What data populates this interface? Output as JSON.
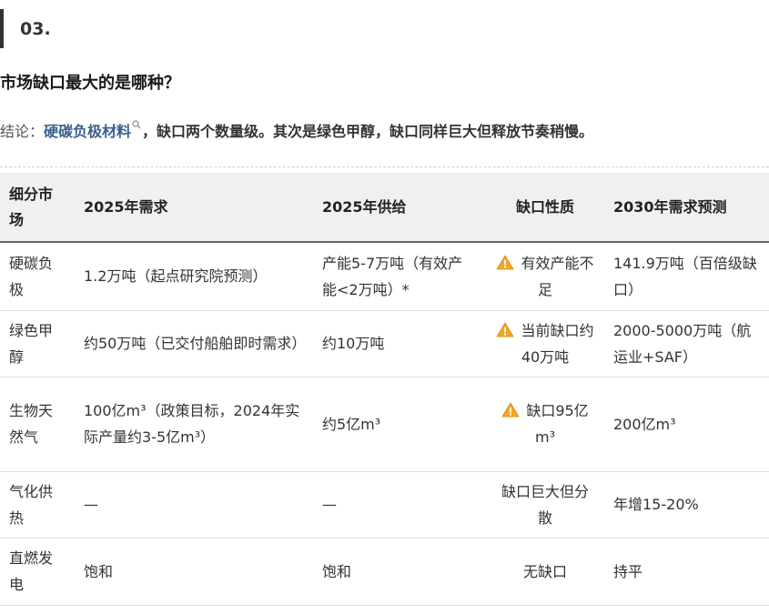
{
  "section": {
    "number": "03."
  },
  "question": "市场缺口最大的是哪种？",
  "conclusion": {
    "lead": "结论：",
    "highlight": "硬碳负极材料",
    "rest": "，缺口两个数量级。其次是绿色甲醇，缺口同样巨大但释放节奏稍慢。"
  },
  "icons": {
    "search": "search-icon",
    "warning": "warning-icon"
  },
  "colors": {
    "link": "#3b5f8f",
    "warning": "#f5a623",
    "header_bg": "#eef0f2"
  },
  "table": {
    "headers": [
      "细分市场",
      "2025年需求",
      "2025年供给",
      "缺口性质",
      "2030年需求预测"
    ],
    "rows": [
      {
        "segment": "硬碳负极",
        "demand_2025": "1.2万吨（起点研究院预测）",
        "supply_2025": "产能5-7万吨（有效产能<2万吨）*",
        "gap": "有效产能不足",
        "gap_warning": true,
        "forecast_2030": "141.9万吨（百倍级缺口）"
      },
      {
        "segment": "绿色甲醇",
        "demand_2025": "约50万吨（已交付船舶即时需求）",
        "supply_2025": "约10万吨",
        "gap": "当前缺口约40万吨",
        "gap_warning": true,
        "forecast_2030": "2000-5000万吨（航运业+SAF）"
      },
      {
        "segment": "生物天然气",
        "demand_2025": "100亿m³（政策目标，2024年实际产量约3-5亿m³）",
        "supply_2025": "约5亿m³",
        "gap": "缺口95亿m³",
        "gap_warning": true,
        "forecast_2030": "200亿m³"
      },
      {
        "segment": "气化供热",
        "demand_2025": "—",
        "supply_2025": "—",
        "gap": "缺口巨大但分散",
        "gap_warning": false,
        "forecast_2030": "年增15-20%"
      },
      {
        "segment": "直燃发电",
        "demand_2025": "饱和",
        "supply_2025": "饱和",
        "gap": "无缺口",
        "gap_warning": false,
        "forecast_2030": "持平"
      }
    ]
  }
}
